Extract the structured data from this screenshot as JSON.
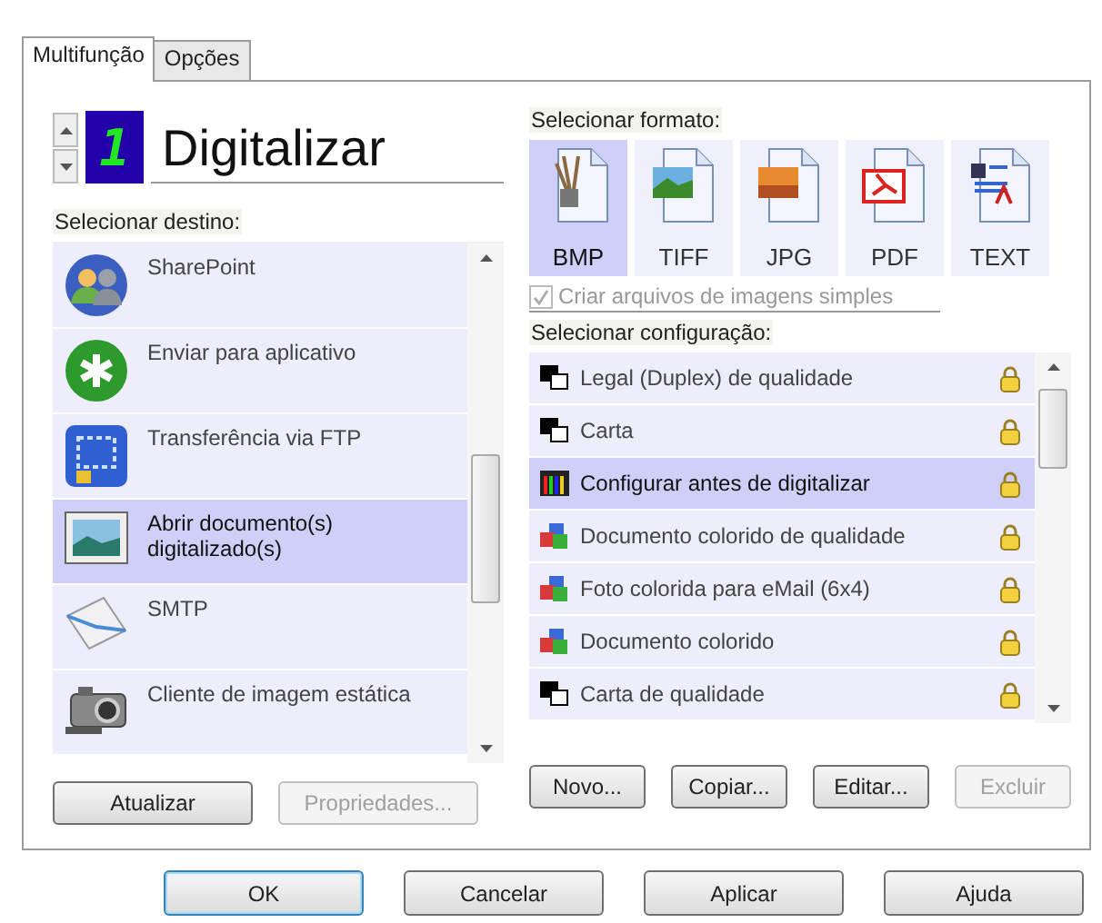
{
  "tabs": [
    {
      "label": "Multifunção",
      "selected": true
    },
    {
      "label": "Opções",
      "selected": false
    }
  ],
  "profile": {
    "number": "1",
    "name": "Digitalizar"
  },
  "destinations": {
    "label": "Selecionar destino:",
    "items": [
      {
        "name": "SharePoint",
        "kind": "people",
        "selected": false
      },
      {
        "name": "Enviar para aplicativo",
        "kind": "app",
        "selected": false
      },
      {
        "name": "Transferência via FTP",
        "kind": "ftp",
        "selected": false
      },
      {
        "name": "Abrir documento(s) digitalizado(s)",
        "kind": "picture",
        "selected": true
      },
      {
        "name": "SMTP",
        "kind": "mail",
        "selected": false
      },
      {
        "name": "Cliente de imagem estática",
        "kind": "camera",
        "selected": false
      }
    ],
    "buttons": [
      {
        "label": "Atualizar",
        "disabled": false
      },
      {
        "label": "Propriedades...",
        "disabled": true
      }
    ]
  },
  "formats": {
    "label": "Selecionar formato:",
    "items": [
      {
        "label": "BMP",
        "kind": "bmp",
        "selected": true
      },
      {
        "label": "TIFF",
        "kind": "tiff",
        "selected": false
      },
      {
        "label": "JPG",
        "kind": "jpg",
        "selected": false
      },
      {
        "label": "PDF",
        "kind": "pdf",
        "selected": false
      },
      {
        "label": "TEXT",
        "kind": "text",
        "selected": false
      }
    ],
    "single_files": {
      "label": "Criar arquivos de imagens simples",
      "checked": true,
      "disabled": true
    }
  },
  "configurations": {
    "label": "Selecionar configuração:",
    "items": [
      {
        "name": "Legal (Duplex) de qualidade",
        "kind": "bw",
        "locked": true,
        "selected": false
      },
      {
        "name": "Carta",
        "kind": "bw",
        "locked": true,
        "selected": false
      },
      {
        "name": "Configurar antes de digitalizar",
        "kind": "palette",
        "locked": true,
        "selected": true
      },
      {
        "name": "Documento colorido de qualidade",
        "kind": "color",
        "locked": true,
        "selected": false
      },
      {
        "name": "Foto colorida para eMail (6x4)",
        "kind": "color",
        "locked": true,
        "selected": false
      },
      {
        "name": "Documento colorido",
        "kind": "color",
        "locked": true,
        "selected": false
      },
      {
        "name": "Carta de qualidade",
        "kind": "bw",
        "locked": true,
        "selected": false
      }
    ],
    "buttons": [
      {
        "label": "Novo...",
        "disabled": false
      },
      {
        "label": "Copiar...",
        "disabled": false
      },
      {
        "label": "Editar...",
        "disabled": false
      },
      {
        "label": "Excluir",
        "disabled": true
      }
    ]
  },
  "dialog_buttons": [
    {
      "label": "OK",
      "default": true
    },
    {
      "label": "Cancelar",
      "default": false
    },
    {
      "label": "Aplicar",
      "default": false
    },
    {
      "label": "Ajuda",
      "default": false
    }
  ]
}
